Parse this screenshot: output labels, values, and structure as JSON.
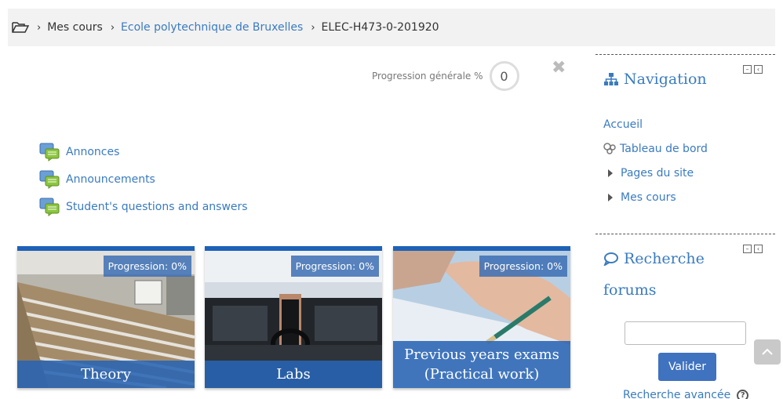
{
  "breadcrumb": {
    "items": [
      {
        "label": "Mes cours"
      },
      {
        "label": "Ecole polytechnique de Bruxelles"
      },
      {
        "label": "ELEC-H473-0-201920"
      }
    ]
  },
  "progress": {
    "label": "Progression générale %",
    "value": "0"
  },
  "close_symbol": "✖",
  "forums": [
    {
      "label": "Annonces"
    },
    {
      "label": "Announcements"
    },
    {
      "label": "Student's questions and answers"
    }
  ],
  "tiles": [
    {
      "badge": "Progression: 0%",
      "title": "Theory"
    },
    {
      "badge": "Progression: 0%",
      "title": "Labs"
    },
    {
      "badge": "Progression: 0%",
      "title_line1": "Previous years exams",
      "title_line2": "(Practical work)"
    }
  ],
  "navigation": {
    "title": "Navigation",
    "items": [
      {
        "label": "Accueil"
      },
      {
        "label": "Tableau de bord"
      },
      {
        "label": "Pages du site"
      },
      {
        "label": "Mes cours"
      }
    ]
  },
  "search_forums": {
    "title_line1": "Recherche",
    "title_line2": "forums",
    "input_value": "",
    "button_label": "Valider",
    "advanced_label": "Recherche avancée"
  },
  "colors": {
    "accent": "#3a7bbf",
    "tile_border": "#1e62b7",
    "button": "#3f72bf"
  },
  "icons": {
    "home": "folder-open-icon",
    "forum": "forum-icon",
    "navigation": "sitemap-icon",
    "search": "comment-search-icon"
  }
}
